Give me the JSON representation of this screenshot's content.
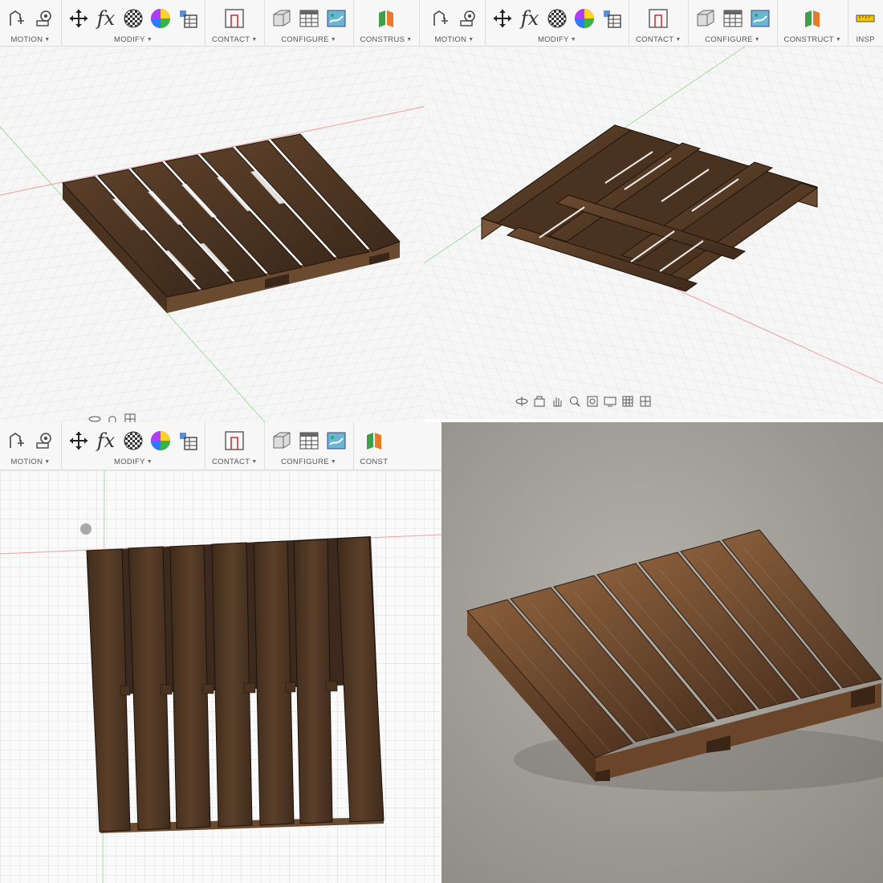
{
  "toolbar_labels": {
    "motion": "MOTION",
    "modify": "MODIFY",
    "contact": "CONTACT",
    "configure": "CONFIGURE",
    "construct_cut_tl": "CONSTRUS",
    "construct": "CONSTRUCT",
    "construct_cut_bl": "CONST",
    "inspect_cut": "INSP"
  },
  "icons": [
    "joint-icon",
    "joint-origin-icon",
    "move-icon",
    "formula-fx-icon",
    "appearance-checker-icon",
    "color-wheel-icon",
    "parameters-table-icon",
    "contact-sets-icon",
    "configure-box-icon",
    "configure-table-icon",
    "configure-map-icon",
    "construct-plane-icon",
    "measure-icon",
    "orbit-icon",
    "look-at-icon",
    "pan-hand-icon",
    "zoom-icon",
    "fit-icon",
    "display-settings-icon",
    "grid-icon",
    "viewports-icon"
  ],
  "colors": {
    "wood_dark": "#3f2b1c",
    "wood_mid": "#5b3f29",
    "wood_light": "#7a5638",
    "grid_line": "#e3e3e3",
    "axis_red": "#e88c8c",
    "axis_green": "#8fd48f",
    "concrete": "#a8a49e"
  }
}
